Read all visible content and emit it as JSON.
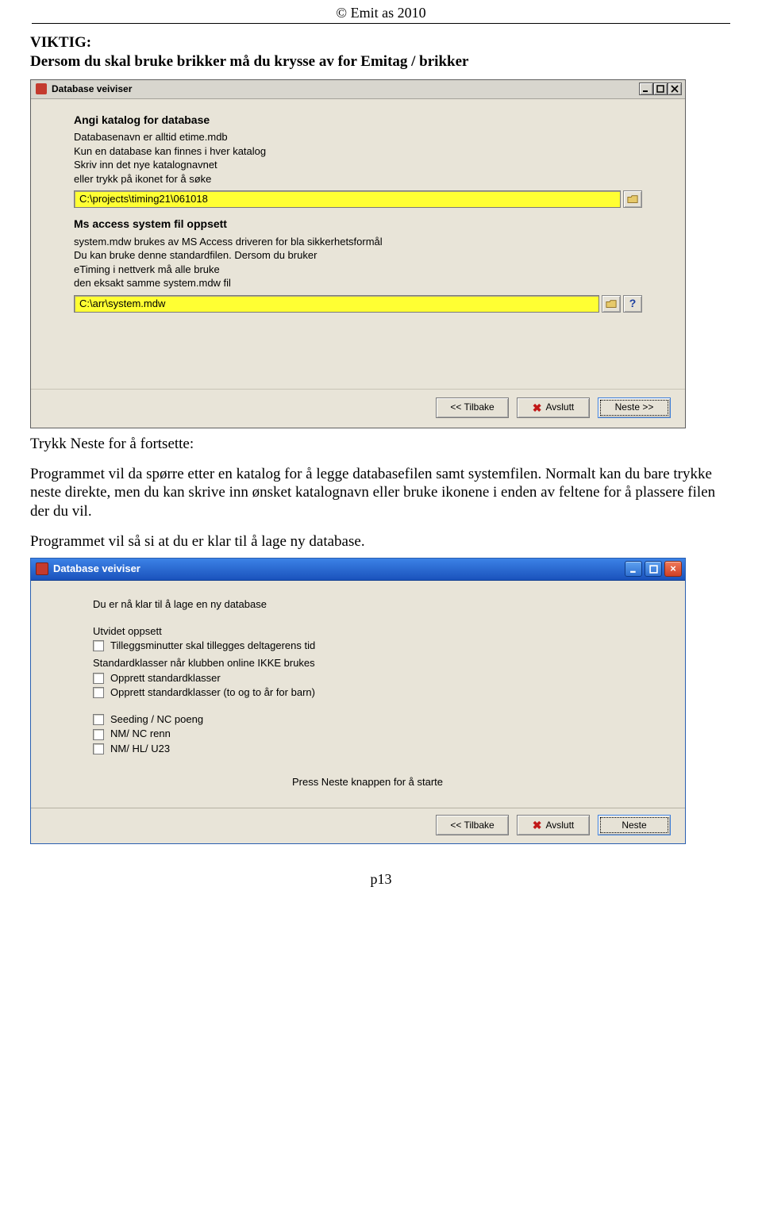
{
  "header": {
    "copyright": "© Emit as 2010"
  },
  "text": {
    "viktig_label": "VIKTIG:",
    "viktig_body": "Dersom du skal bruke brikker må du krysse av for Emitag / brikker",
    "trykk_neste": "Trykk Neste for å fortsette:",
    "para2": "Programmet vil da spørre etter en katalog for å legge databasefilen samt systemfilen. Normalt kan du bare trykke neste direkte, men du kan skrive inn ønsket katalognavn eller bruke ikonene i enden av feltene for å plassere filen der du vil.",
    "para3": "Programmet vil så si at du er klar til å lage ny database."
  },
  "win1": {
    "title": "Database veiviser",
    "sec1_head": "Angi katalog for database",
    "sec1_lines": [
      "Databasenavn er alltid etime.mdb",
      "Kun en database kan finnes i hver katalog",
      "Skriv inn det nye katalognavnet",
      "eller trykk på ikonet for å søke"
    ],
    "path1": "C:\\projects\\timing21\\061018",
    "sec2_head": "Ms access system fil oppsett",
    "sec2_lines": [
      "system.mdw brukes av MS Access driveren for bla sikkerhetsformål",
      "Du kan bruke denne standardfilen. Dersom du bruker",
      "eTiming  i nettverk må alle bruke",
      "den eksakt samme system.mdw fil"
    ],
    "path2": "C:\\arr\\system.mdw",
    "btn_back": "<< Tilbake",
    "btn_cancel": "Avslutt",
    "btn_next": "Neste >>"
  },
  "win2": {
    "title": "Database veiviser",
    "heading": "Du er nå klar til å lage en ny database",
    "sec_a": "Utvidet oppsett",
    "cb_a1": "Tilleggsminutter skal tillegges deltagerens tid",
    "sec_b": "Standardklasser når klubben online IKKE brukes",
    "cb_b1": "Opprett standardklasser",
    "cb_b2": "Opprett standardklasser (to og to år for barn)",
    "cb_c1": "Seeding / NC poeng",
    "cb_c2": "NM/ NC renn",
    "cb_c3": "NM/ HL/ U23",
    "hint": "Press  Neste  knappen for å starte",
    "btn_back": "<< Tilbake",
    "btn_cancel": "Avslutt",
    "btn_next": "Neste"
  },
  "footer": {
    "page": "p13"
  }
}
